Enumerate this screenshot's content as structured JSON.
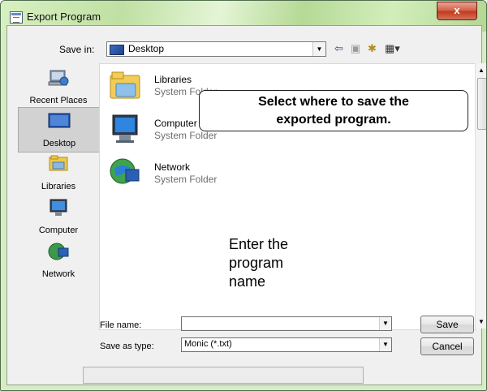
{
  "window": {
    "title": "Export Program",
    "close_glyph": "x"
  },
  "toolbar": {
    "save_in_label": "Save in:",
    "save_in_value": "Desktop",
    "icons": [
      "back-arrow-icon",
      "up-folder-icon",
      "new-folder-icon",
      "view-menu-icon"
    ]
  },
  "places": [
    {
      "label": "Recent Places",
      "icon": "recent-places-icon"
    },
    {
      "label": "Desktop",
      "icon": "desktop-icon",
      "selected": true
    },
    {
      "label": "Libraries",
      "icon": "libraries-icon"
    },
    {
      "label": "Computer",
      "icon": "computer-icon"
    },
    {
      "label": "Network",
      "icon": "network-icon"
    }
  ],
  "files": [
    {
      "name": "Libraries",
      "type": "System Folder",
      "icon": "libraries-icon"
    },
    {
      "name": "Computer",
      "type": "System Folder",
      "icon": "computer-icon"
    },
    {
      "name": "Network",
      "type": "System Folder",
      "icon": "network-icon"
    }
  ],
  "callout": {
    "line1": "Select where to save the",
    "line2": "exported program."
  },
  "note": {
    "line1": "Enter the",
    "line2": "program",
    "line3": "name"
  },
  "form": {
    "file_name_label": "File name:",
    "file_name_value": "",
    "save_as_type_label": "Save as type:",
    "save_as_type_value": "Monic (*.txt)"
  },
  "buttons": {
    "save": "Save",
    "cancel": "Cancel"
  }
}
